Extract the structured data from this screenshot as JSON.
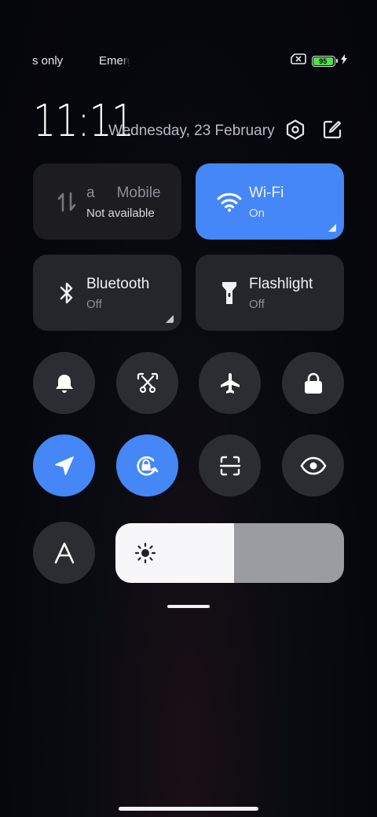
{
  "status_bar": {
    "carrier_1": "s only",
    "carrier_2": "Emerg",
    "battery_level": 95,
    "battery_label": "95",
    "icons": [
      "no-sim-icon",
      "battery-icon",
      "charging-bolt-icon"
    ]
  },
  "header": {
    "time": "11:11",
    "date": "Wednesday, 23 February",
    "icons": [
      "settings-icon",
      "edit-icon"
    ]
  },
  "tiles": {
    "mobile": {
      "title": "Mobile",
      "title_prefix": "a",
      "status": "Not available",
      "icon": "mobile-data-icon"
    },
    "wifi": {
      "title": "Wi-Fi",
      "status": "On",
      "icon": "wifi-icon",
      "active": true
    },
    "bluetooth": {
      "title": "Bluetooth",
      "status": "Off",
      "icon": "bluetooth-icon"
    },
    "flashlight": {
      "title": "Flashlight",
      "status": "Off",
      "icon": "flashlight-icon"
    }
  },
  "toggles": [
    {
      "icon": "bell-icon",
      "active": false
    },
    {
      "icon": "screenshot-scissors-icon",
      "active": false
    },
    {
      "icon": "airplane-icon",
      "active": false
    },
    {
      "icon": "lock-icon",
      "active": false
    },
    {
      "icon": "location-icon",
      "active": true
    },
    {
      "icon": "rotation-lock-icon",
      "active": true
    },
    {
      "icon": "scanner-icon",
      "active": false
    },
    {
      "icon": "eye-icon",
      "active": false
    },
    {
      "icon": "font-size-icon",
      "active": false
    }
  ],
  "brightness": {
    "level": 0.52,
    "icon": "sun-icon"
  },
  "colors": {
    "accent": "#4587f7",
    "tile_bg": "#25262c",
    "button_bg": "#2c2d33",
    "battery": "#4ee04a"
  }
}
